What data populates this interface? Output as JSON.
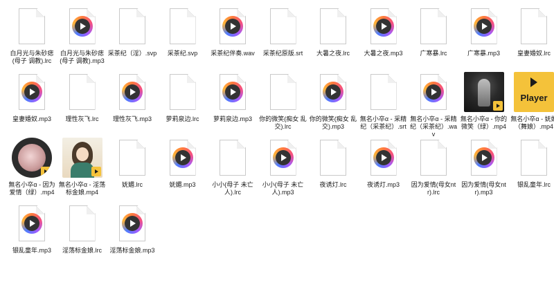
{
  "files": [
    {
      "name": "白月光与朱砂痣(母子 调教).lrc",
      "kind": "doc",
      "icon": "text-file-icon"
    },
    {
      "name": "白月光与朱砂痣(母子 调教).mp3",
      "kind": "media",
      "icon": "audio-file-icon"
    },
    {
      "name": "采茶纪（淫）.svp",
      "kind": "doc",
      "icon": "text-file-icon"
    },
    {
      "name": "采茶纪.svp",
      "kind": "doc",
      "icon": "text-file-icon"
    },
    {
      "name": "采茶纪伴奏.wav",
      "kind": "media",
      "icon": "audio-file-icon"
    },
    {
      "name": "采茶纪原版.srt",
      "kind": "doc",
      "icon": "text-file-icon"
    },
    {
      "name": "大暑之夜.lrc",
      "kind": "doc",
      "icon": "text-file-icon"
    },
    {
      "name": "大暑之夜.mp3",
      "kind": "media",
      "icon": "audio-file-icon"
    },
    {
      "name": "广寒暴.lrc",
      "kind": "doc",
      "icon": "text-file-icon"
    },
    {
      "name": "广寒暴.mp3",
      "kind": "media",
      "icon": "audio-file-icon"
    },
    {
      "name": "皇妻婚奴.lrc",
      "kind": "doc",
      "icon": "text-file-icon"
    },
    {
      "name": "皇妻婚奴.mp3",
      "kind": "media",
      "icon": "audio-file-icon"
    },
    {
      "name": "理性灰飞.lrc",
      "kind": "doc",
      "icon": "text-file-icon"
    },
    {
      "name": "理性灰飞.mp3",
      "kind": "media",
      "icon": "audio-file-icon"
    },
    {
      "name": "萝莉泉边.lrc",
      "kind": "doc",
      "icon": "text-file-icon"
    },
    {
      "name": "萝莉泉边.mp3",
      "kind": "media",
      "icon": "audio-file-icon"
    },
    {
      "name": "你的微笑(痴女 乱交).lrc",
      "kind": "doc",
      "icon": "text-file-icon"
    },
    {
      "name": "你的微笑(痴女 乱交).mp3",
      "kind": "media",
      "icon": "audio-file-icon"
    },
    {
      "name": "無名小卒α - 采精纪（采茶纪）.srt",
      "kind": "doc",
      "icon": "text-file-icon"
    },
    {
      "name": "無名小卒α - 采精纪（采茶纪）.wav",
      "kind": "media",
      "icon": "audio-file-icon"
    },
    {
      "name": "無名小卒α - 你的微笑（绿）.mp4",
      "kind": "video-dark",
      "icon": "video-thumbnail-icon"
    },
    {
      "name": "無名小卒α - 妩媚（舞娘）.mp4",
      "kind": "video-player",
      "icon": "player-icon",
      "player_text": "Player"
    },
    {
      "name": "無名小卒α - 因为爱情（绿）.mp4",
      "kind": "video-circle",
      "icon": "video-thumbnail-icon"
    },
    {
      "name": "無名小卒α - 淫荡标金娘.mp4",
      "kind": "video-anime",
      "icon": "video-thumbnail-icon"
    },
    {
      "name": "妩媚.lrc",
      "kind": "doc",
      "icon": "text-file-icon"
    },
    {
      "name": "妩媚.mp3",
      "kind": "media",
      "icon": "audio-file-icon"
    },
    {
      "name": "小小(母子 未亡人).lrc",
      "kind": "doc",
      "icon": "text-file-icon"
    },
    {
      "name": "小小(母子 未亡人).mp3",
      "kind": "media",
      "icon": "audio-file-icon"
    },
    {
      "name": "夜诱灯.lrc",
      "kind": "doc",
      "icon": "text-file-icon"
    },
    {
      "name": "夜诱灯.mp3",
      "kind": "media",
      "icon": "audio-file-icon"
    },
    {
      "name": "因为爱情(母女ntr).lrc",
      "kind": "doc",
      "icon": "text-file-icon"
    },
    {
      "name": "因为爱情(母女ntr).mp3",
      "kind": "media",
      "icon": "audio-file-icon"
    },
    {
      "name": "银乱童年.lrc",
      "kind": "doc",
      "icon": "text-file-icon"
    },
    {
      "name": "银乱童年.mp3",
      "kind": "media",
      "icon": "audio-file-icon"
    },
    {
      "name": "淫荡标金娘.lrc",
      "kind": "doc",
      "icon": "text-file-icon"
    },
    {
      "name": "淫荡标金娘.mp3",
      "kind": "media",
      "icon": "audio-file-icon"
    }
  ]
}
